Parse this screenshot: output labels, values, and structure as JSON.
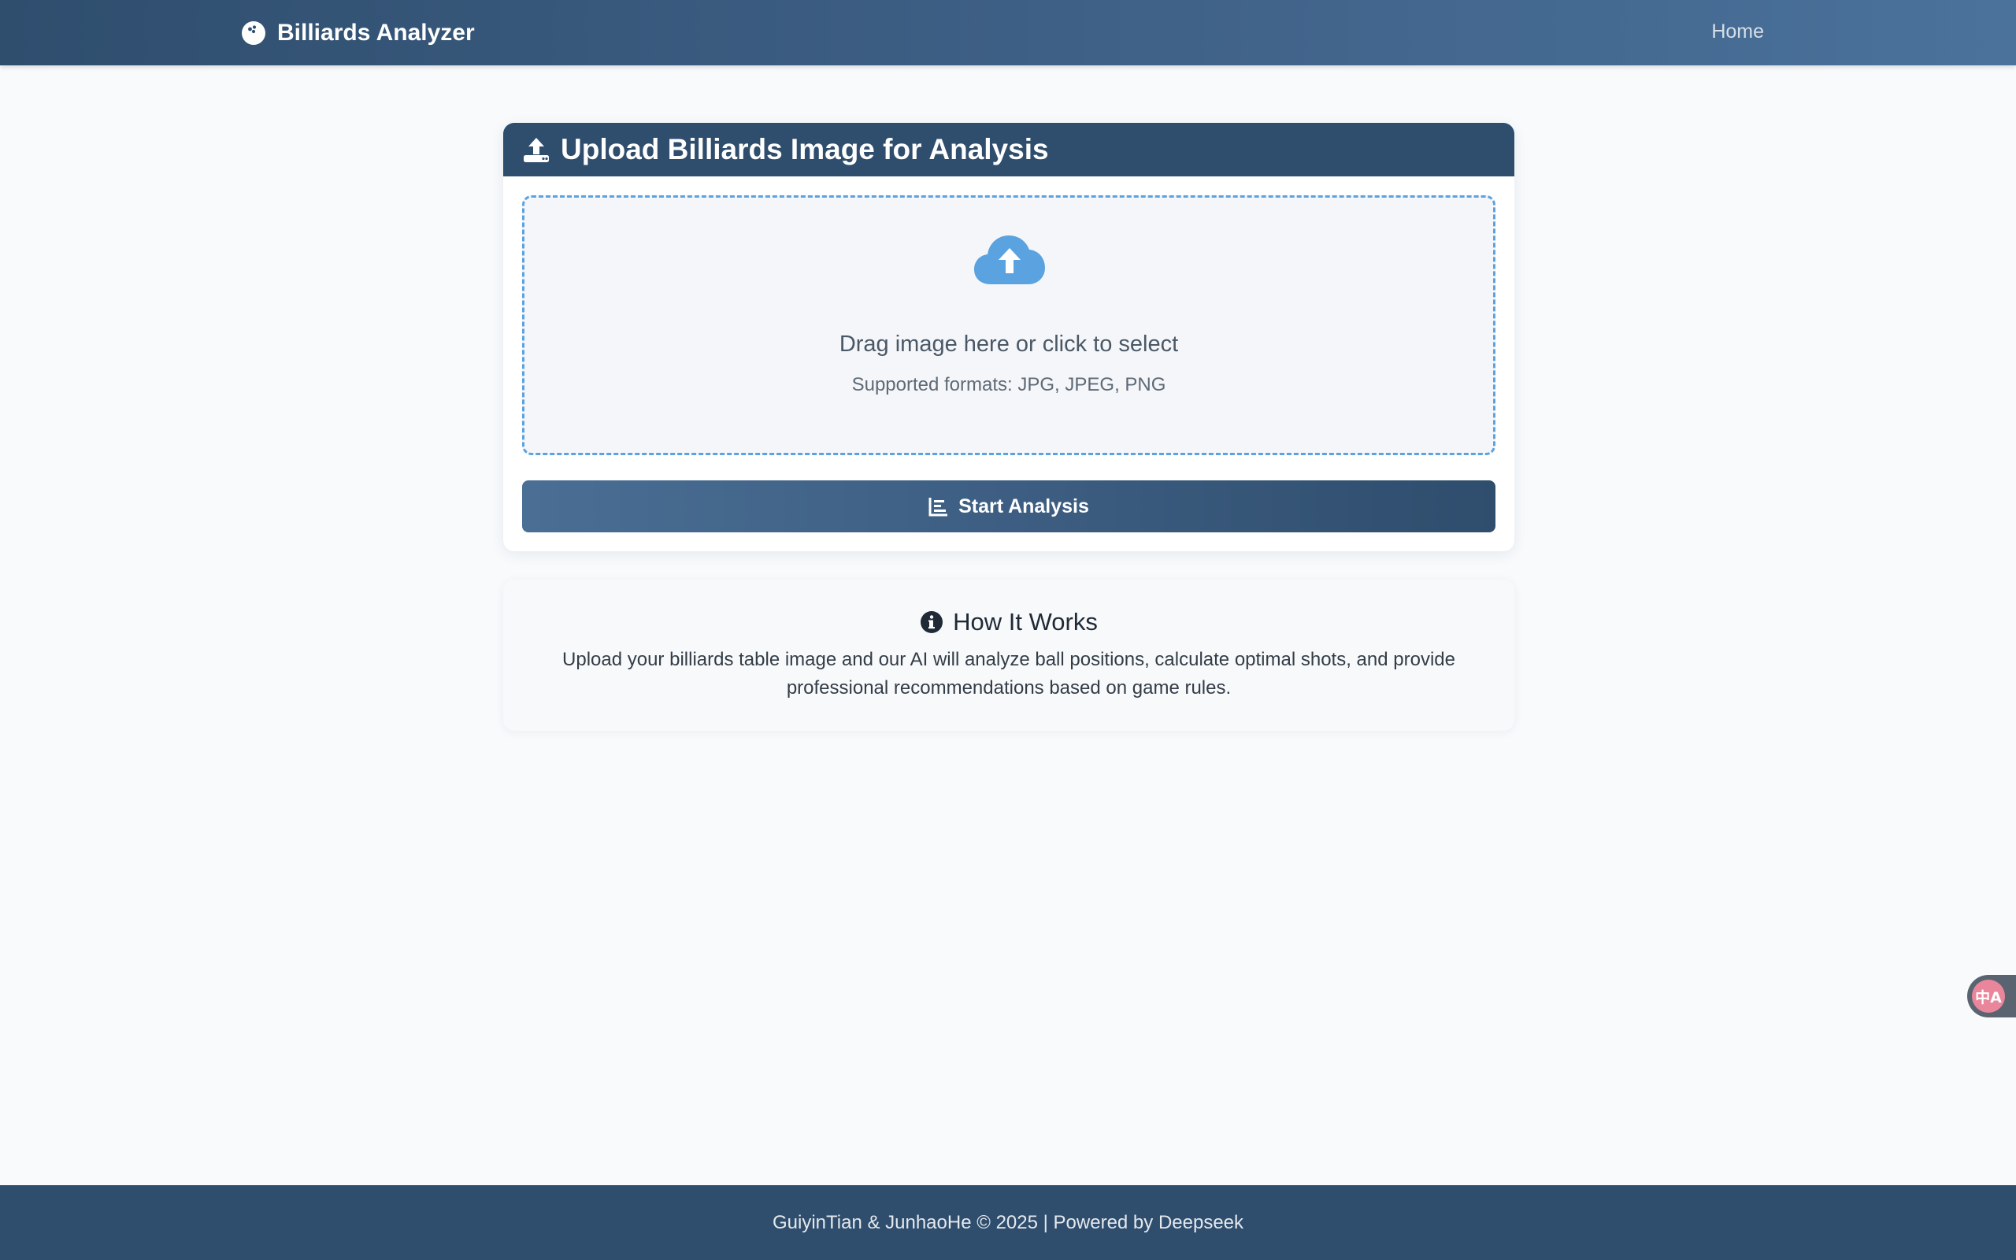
{
  "navbar": {
    "brand": "Billiards Analyzer",
    "brand_icon": "billiard-ball-icon",
    "home_link": "Home"
  },
  "upload": {
    "header_icon": "upload-icon",
    "title": "Upload Billiards Image for Analysis",
    "dropzone_icon": "cloud-upload-icon",
    "dropzone_title": "Drag image here or click to select",
    "dropzone_formats": "Supported formats: JPG, JPEG, PNG",
    "button_icon": "bar-chart-icon",
    "button_label": "Start Analysis"
  },
  "how_it_works": {
    "icon": "info-icon",
    "title": "How It Works",
    "text": "Upload your billiards table image and our AI will analyze ball positions, calculate optimal shots, and provide professional recommendations based on game rules."
  },
  "footer": {
    "text": "GuiyinTian & JunhaoHe © 2025 | Powered by Deepseek"
  },
  "floating_widget": {
    "icon": "translate-icon",
    "glyph": "中A"
  },
  "colors": {
    "navbar": "#3e5f85",
    "card_header": "#2f4d6d",
    "dropzone_border": "#5ba3e0",
    "cloud_icon": "#5ba3e0",
    "footer": "#2f4d6d",
    "translate_accent": "#e9869c"
  }
}
